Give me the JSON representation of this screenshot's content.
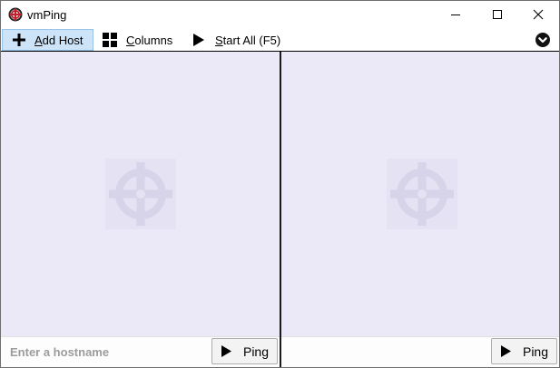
{
  "window": {
    "title": "vmPing"
  },
  "toolbar": {
    "add_host": {
      "accel": "A",
      "rest": "dd Host"
    },
    "columns": {
      "accel": "C",
      "rest": "olumns"
    },
    "start_all": {
      "accel": "S",
      "rest": "tart All (F5)"
    },
    "options_icon": "chevron-down-circle-icon"
  },
  "panes": [
    {
      "placeholder": "Enter a hostname",
      "ping_label": "Ping",
      "watermark_icon": "crosshair-icon"
    },
    {
      "placeholder": "",
      "ping_label": "Ping",
      "watermark_icon": "crosshair-icon"
    }
  ],
  "colors": {
    "pane_background": "#ebe8f8",
    "active_button": "#cde3f7",
    "app_icon": "#c0202b"
  }
}
